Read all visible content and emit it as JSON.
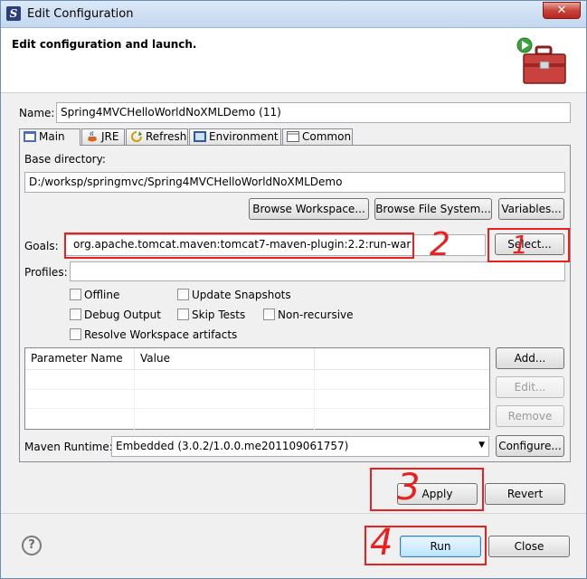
{
  "window": {
    "title": "Edit Configuration",
    "close_glyph": "✕"
  },
  "header": {
    "title": "Edit configuration and launch."
  },
  "name": {
    "label": "Name:",
    "value": "Spring4MVCHelloWorldNoXMLDemo (11)"
  },
  "tabs": [
    {
      "label": "Main",
      "icon": "main-tab-icon"
    },
    {
      "label": "JRE",
      "icon": "jre-icon"
    },
    {
      "label": "Refresh",
      "icon": "refresh-icon"
    },
    {
      "label": "Environment",
      "icon": "environment-icon"
    },
    {
      "label": "Common",
      "icon": "common-icon"
    }
  ],
  "main": {
    "base_directory_label": "Base directory:",
    "base_directory_value": "D:/worksp/springmvc/Spring4MVCHelloWorldNoXMLDemo",
    "browse_workspace": "Browse Workspace...",
    "browse_file_system": "Browse File System...",
    "variables": "Variables...",
    "goals_label": "Goals:",
    "goals_value": "org.apache.tomcat.maven:tomcat7-maven-plugin:2.2:run-war",
    "select": "Select...",
    "profiles_label": "Profiles:",
    "profiles_value": "",
    "checkboxes": {
      "offline": "Offline",
      "update_snapshots": "Update Snapshots",
      "debug_output": "Debug Output",
      "skip_tests": "Skip Tests",
      "non_recursive": "Non-recursive",
      "resolve_workspace": "Resolve Workspace artifacts"
    },
    "param_table": {
      "columns": [
        "Parameter Name",
        "Value"
      ]
    },
    "add": "Add...",
    "edit": "Edit...",
    "remove": "Remove",
    "runtime_label": "Maven Runtime:",
    "runtime_value": "Embedded (3.0.2/1.0.0.me201109061757)",
    "configure": "Configure..."
  },
  "apply": "Apply",
  "revert": "Revert",
  "run": "Run",
  "close": "Close",
  "help_glyph": "?",
  "annotations": {
    "n1": "1",
    "n2": "2",
    "n3": "3",
    "n4": "4"
  },
  "colors": {
    "annotation_red": "#e8201f",
    "titlebar": "#c3d7ef",
    "default_button": "#bee6fd"
  }
}
